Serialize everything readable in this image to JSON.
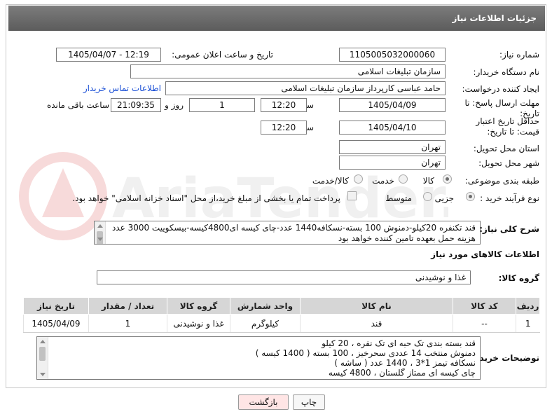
{
  "header": {
    "title": "جزئیات اطلاعات نیاز"
  },
  "form": {
    "need_number": {
      "label": "شماره نیاز:",
      "value": "1105005032000060"
    },
    "announce_datetime": {
      "label": "تاریخ و ساعت اعلان عمومی:",
      "value": "1405/04/07 - 12:19"
    },
    "buyer_org": {
      "label": "نام دستگاه خریدار:",
      "value": "سازمان تبلیغات اسلامی"
    },
    "requester": {
      "label": "ایجاد کننده درخواست:",
      "value": "حامد عباسی کارپرداز سازمان تبلیغات اسلامی",
      "link": "اطلاعات تماس خریدار"
    },
    "deadline": {
      "label": "مهلت ارسال پاسخ: تا تاریخ:",
      "date": "1405/04/09",
      "time_label": "ساعت",
      "time": "12:20",
      "days": "1",
      "days_label": "روز و",
      "remaining": "21:09:35",
      "remaining_label": "ساعت باقی مانده"
    },
    "price_validity": {
      "label": "حداقل تاریخ اعتبار قیمت: تا تاریخ:",
      "date": "1405/04/10",
      "time_label": "ساعت",
      "time": "12:20"
    },
    "delivery_province": {
      "label": "استان محل تحویل:",
      "value": "تهران"
    },
    "delivery_city": {
      "label": "شهر محل تحویل:",
      "value": "تهران"
    },
    "category": {
      "label": "طبقه بندی موضوعی:",
      "options": [
        "کالا",
        "خدمت",
        "کالا/خدمت"
      ],
      "selected": "کالا"
    },
    "process_type": {
      "label": "نوع فرآیند خرید :",
      "options": [
        "جزیی",
        "متوسط"
      ],
      "selected": "جزیی",
      "payment_note": "پرداخت تمام یا بخشی از مبلغ خرید،از محل \"اسناد خزانه اسلامی\" خواهد بود."
    },
    "description": {
      "label": "شرح کلی نیاز:",
      "value": "قند تکنفره 20کیلو-دمنوش 100 بسته-نسکافه1440 عدد-چای کیسه ای4800کیسه-بیسکوییت 3000 عدد هزینه حمل بعهده تامین کننده خواهد بود"
    }
  },
  "goods_section": {
    "title": "اطلاعات کالاهای مورد نیاز",
    "group_label": "گروه کالا:",
    "group_value": "غذا و نوشیدنی"
  },
  "table": {
    "headers": [
      "ردیف",
      "کد کالا",
      "نام کالا",
      "واحد شمارش",
      "گروه کالا",
      "تعداد / مقدار",
      "تاریخ نیاز"
    ],
    "rows": [
      [
        "1",
        "--",
        "قند",
        "کیلوگرم",
        "غذا و نوشیدنی",
        "1",
        "1405/04/09"
      ]
    ]
  },
  "buyer_notes": {
    "label": "توضیحات خریدار:",
    "lines": [
      "قند بسته بندی تک حبه ای تک نفره ، 20 کیلو",
      "دمنوش منتخب 14 عددی سحرخیز ، 100 بسته ( 1400 کیسه )",
      "نسکافه تیمز 1*3 ، 1440 عدد ( ساشه )",
      "چای کیسه ای ممتاز گلستان ، 4800 کیسه"
    ]
  },
  "buttons": {
    "print": "چاپ",
    "back": "بازگشت"
  },
  "colors": {
    "header_bg": "#6b6b6b",
    "link": "#1a4fd6",
    "back_button_bg": "#ffe5e5"
  },
  "watermark_text": "AriaTender.net"
}
